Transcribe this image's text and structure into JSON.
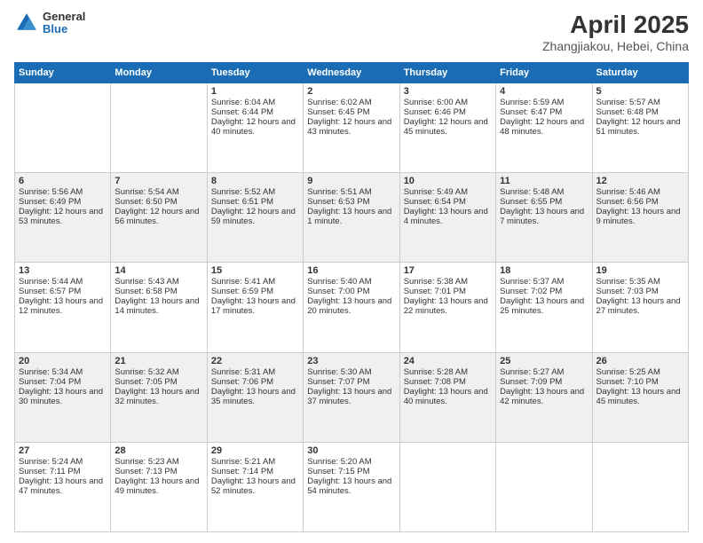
{
  "header": {
    "logo_line1": "General",
    "logo_line2": "Blue",
    "month": "April 2025",
    "location": "Zhangjiakou, Hebei, China"
  },
  "days_of_week": [
    "Sunday",
    "Monday",
    "Tuesday",
    "Wednesday",
    "Thursday",
    "Friday",
    "Saturday"
  ],
  "weeks": [
    [
      {
        "day": "",
        "text": ""
      },
      {
        "day": "",
        "text": ""
      },
      {
        "day": "1",
        "text": "Sunrise: 6:04 AM\nSunset: 6:44 PM\nDaylight: 12 hours and 40 minutes."
      },
      {
        "day": "2",
        "text": "Sunrise: 6:02 AM\nSunset: 6:45 PM\nDaylight: 12 hours and 43 minutes."
      },
      {
        "day": "3",
        "text": "Sunrise: 6:00 AM\nSunset: 6:46 PM\nDaylight: 12 hours and 45 minutes."
      },
      {
        "day": "4",
        "text": "Sunrise: 5:59 AM\nSunset: 6:47 PM\nDaylight: 12 hours and 48 minutes."
      },
      {
        "day": "5",
        "text": "Sunrise: 5:57 AM\nSunset: 6:48 PM\nDaylight: 12 hours and 51 minutes."
      }
    ],
    [
      {
        "day": "6",
        "text": "Sunrise: 5:56 AM\nSunset: 6:49 PM\nDaylight: 12 hours and 53 minutes."
      },
      {
        "day": "7",
        "text": "Sunrise: 5:54 AM\nSunset: 6:50 PM\nDaylight: 12 hours and 56 minutes."
      },
      {
        "day": "8",
        "text": "Sunrise: 5:52 AM\nSunset: 6:51 PM\nDaylight: 12 hours and 59 minutes."
      },
      {
        "day": "9",
        "text": "Sunrise: 5:51 AM\nSunset: 6:53 PM\nDaylight: 13 hours and 1 minute."
      },
      {
        "day": "10",
        "text": "Sunrise: 5:49 AM\nSunset: 6:54 PM\nDaylight: 13 hours and 4 minutes."
      },
      {
        "day": "11",
        "text": "Sunrise: 5:48 AM\nSunset: 6:55 PM\nDaylight: 13 hours and 7 minutes."
      },
      {
        "day": "12",
        "text": "Sunrise: 5:46 AM\nSunset: 6:56 PM\nDaylight: 13 hours and 9 minutes."
      }
    ],
    [
      {
        "day": "13",
        "text": "Sunrise: 5:44 AM\nSunset: 6:57 PM\nDaylight: 13 hours and 12 minutes."
      },
      {
        "day": "14",
        "text": "Sunrise: 5:43 AM\nSunset: 6:58 PM\nDaylight: 13 hours and 14 minutes."
      },
      {
        "day": "15",
        "text": "Sunrise: 5:41 AM\nSunset: 6:59 PM\nDaylight: 13 hours and 17 minutes."
      },
      {
        "day": "16",
        "text": "Sunrise: 5:40 AM\nSunset: 7:00 PM\nDaylight: 13 hours and 20 minutes."
      },
      {
        "day": "17",
        "text": "Sunrise: 5:38 AM\nSunset: 7:01 PM\nDaylight: 13 hours and 22 minutes."
      },
      {
        "day": "18",
        "text": "Sunrise: 5:37 AM\nSunset: 7:02 PM\nDaylight: 13 hours and 25 minutes."
      },
      {
        "day": "19",
        "text": "Sunrise: 5:35 AM\nSunset: 7:03 PM\nDaylight: 13 hours and 27 minutes."
      }
    ],
    [
      {
        "day": "20",
        "text": "Sunrise: 5:34 AM\nSunset: 7:04 PM\nDaylight: 13 hours and 30 minutes."
      },
      {
        "day": "21",
        "text": "Sunrise: 5:32 AM\nSunset: 7:05 PM\nDaylight: 13 hours and 32 minutes."
      },
      {
        "day": "22",
        "text": "Sunrise: 5:31 AM\nSunset: 7:06 PM\nDaylight: 13 hours and 35 minutes."
      },
      {
        "day": "23",
        "text": "Sunrise: 5:30 AM\nSunset: 7:07 PM\nDaylight: 13 hours and 37 minutes."
      },
      {
        "day": "24",
        "text": "Sunrise: 5:28 AM\nSunset: 7:08 PM\nDaylight: 13 hours and 40 minutes."
      },
      {
        "day": "25",
        "text": "Sunrise: 5:27 AM\nSunset: 7:09 PM\nDaylight: 13 hours and 42 minutes."
      },
      {
        "day": "26",
        "text": "Sunrise: 5:25 AM\nSunset: 7:10 PM\nDaylight: 13 hours and 45 minutes."
      }
    ],
    [
      {
        "day": "27",
        "text": "Sunrise: 5:24 AM\nSunset: 7:11 PM\nDaylight: 13 hours and 47 minutes."
      },
      {
        "day": "28",
        "text": "Sunrise: 5:23 AM\nSunset: 7:13 PM\nDaylight: 13 hours and 49 minutes."
      },
      {
        "day": "29",
        "text": "Sunrise: 5:21 AM\nSunset: 7:14 PM\nDaylight: 13 hours and 52 minutes."
      },
      {
        "day": "30",
        "text": "Sunrise: 5:20 AM\nSunset: 7:15 PM\nDaylight: 13 hours and 54 minutes."
      },
      {
        "day": "",
        "text": ""
      },
      {
        "day": "",
        "text": ""
      },
      {
        "day": "",
        "text": ""
      }
    ]
  ]
}
